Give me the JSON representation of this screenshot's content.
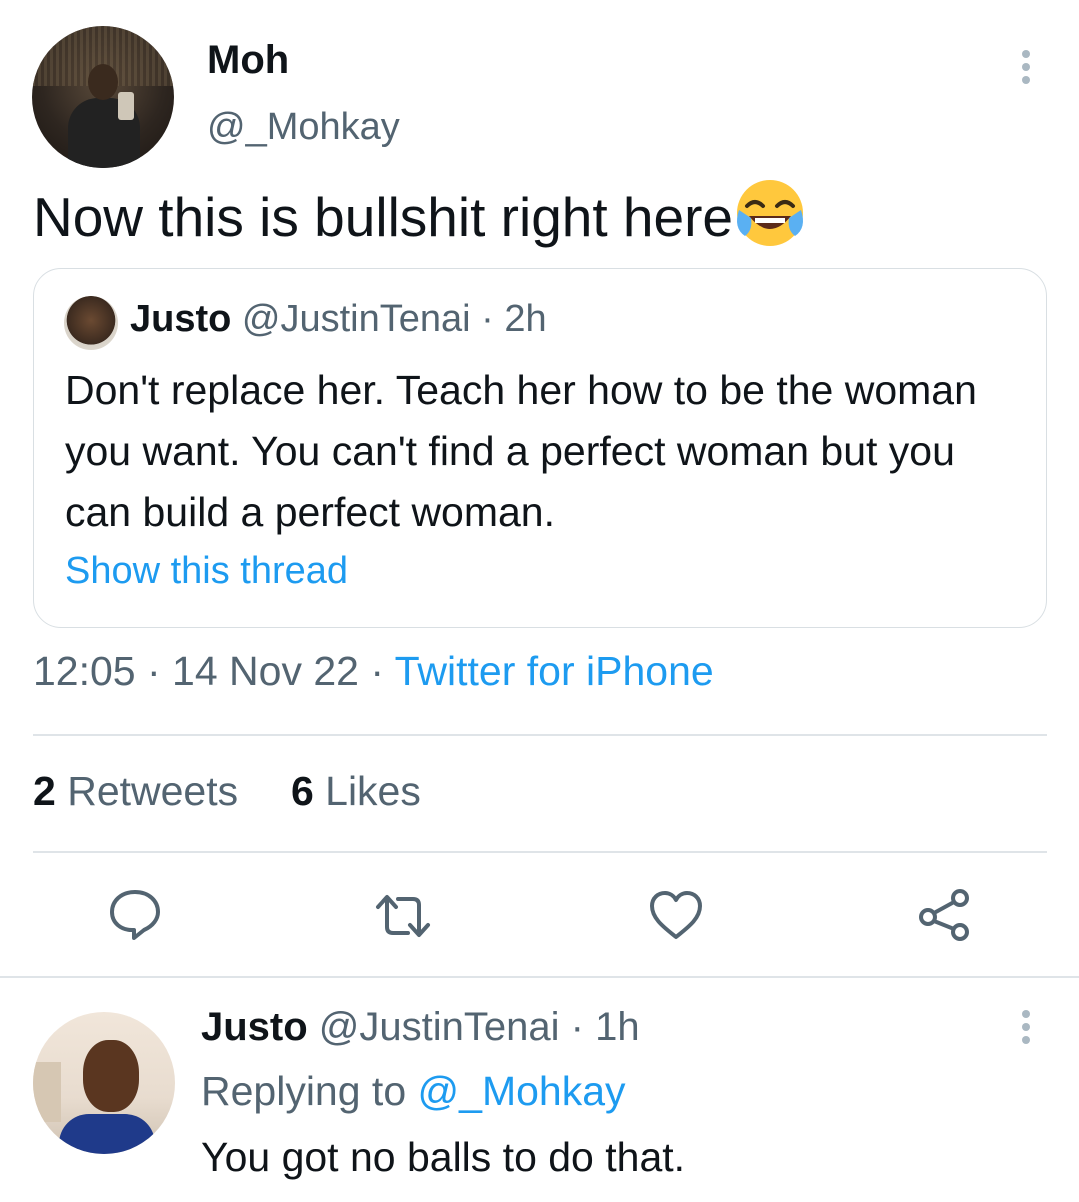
{
  "main_tweet": {
    "author_name": "Moh",
    "author_handle": "@_Mohkay",
    "text": "Now this is bullshit right here",
    "emoji": "face-with-tears-of-joy",
    "timestamp": "12:05 · 14 Nov 22 · ",
    "source": "Twitter for iPhone"
  },
  "quoted_tweet": {
    "author_name": "Justo",
    "author_handle_time": " @JustinTenai · 2h",
    "text": "Don't replace her. Teach her how to be the woman you want. You can't find a perfect woman but you can build a perfect woman.",
    "show_thread_label": "Show this thread"
  },
  "stats": {
    "retweets_count": "2",
    "retweets_label": " Retweets",
    "likes_count": "6",
    "likes_label": " Likes"
  },
  "actions": {
    "icons": [
      "reply-icon",
      "retweet-icon",
      "like-icon",
      "share-icon"
    ],
    "icon_color": "#536471"
  },
  "reply": {
    "author_name": "Justo",
    "author_handle_time": " @JustinTenai · 1h",
    "replying_prefix": "Replying to ",
    "replying_mention": "@_Mohkay",
    "text": "You got no balls to do that."
  },
  "colors": {
    "accent": "#1d9bf0",
    "secondary_text": "#536471",
    "primary_text": "#0f1419",
    "border": "#d9dfe3"
  }
}
